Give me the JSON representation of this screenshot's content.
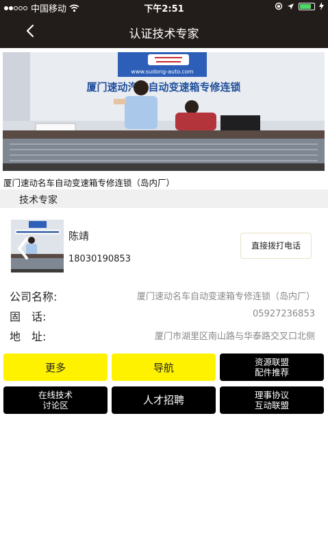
{
  "status_bar": {
    "carrier": "中国移动",
    "time": "下午2:51",
    "battery_level": 0.8
  },
  "nav": {
    "title": "认证技术专家",
    "back_icon": "chevron-left-icon"
  },
  "banner": {
    "sign_url": "www.sudong-auto.com",
    "sign_text": "厦门速动汽车自动变速箱专修连锁"
  },
  "shop_name": "厦门速动名车自动变速箱专修连锁（岛内厂）",
  "section_title": "技术专家",
  "expert": {
    "name": "陈靖",
    "phone": "18030190853",
    "call_label": "直接拨打电话"
  },
  "info": [
    {
      "key": "公司名称:",
      "value": "厦门速动名车自动变速箱专修连锁（岛内厂）"
    },
    {
      "key": "固　话:",
      "value": "05927236853"
    },
    {
      "key": "地　址:",
      "value": "厦门市湖里区南山路与华泰路交叉口北侧"
    }
  ],
  "buttons": [
    {
      "lines": [
        "更多"
      ],
      "style": "yellow"
    },
    {
      "lines": [
        "导航"
      ],
      "style": "yellow"
    },
    {
      "lines": [
        "资源联盟",
        "配件推荐"
      ],
      "style": "black"
    },
    {
      "lines": [
        "在线技术",
        "讨论区"
      ],
      "style": "black"
    },
    {
      "lines": [
        "人才招聘"
      ],
      "style": "black"
    },
    {
      "lines": [
        "理事协议",
        "互动联盟"
      ],
      "style": "black"
    }
  ],
  "colors": {
    "header_bg": "#221c1a",
    "accent_yellow": "#fff200",
    "button_black": "#000000"
  }
}
